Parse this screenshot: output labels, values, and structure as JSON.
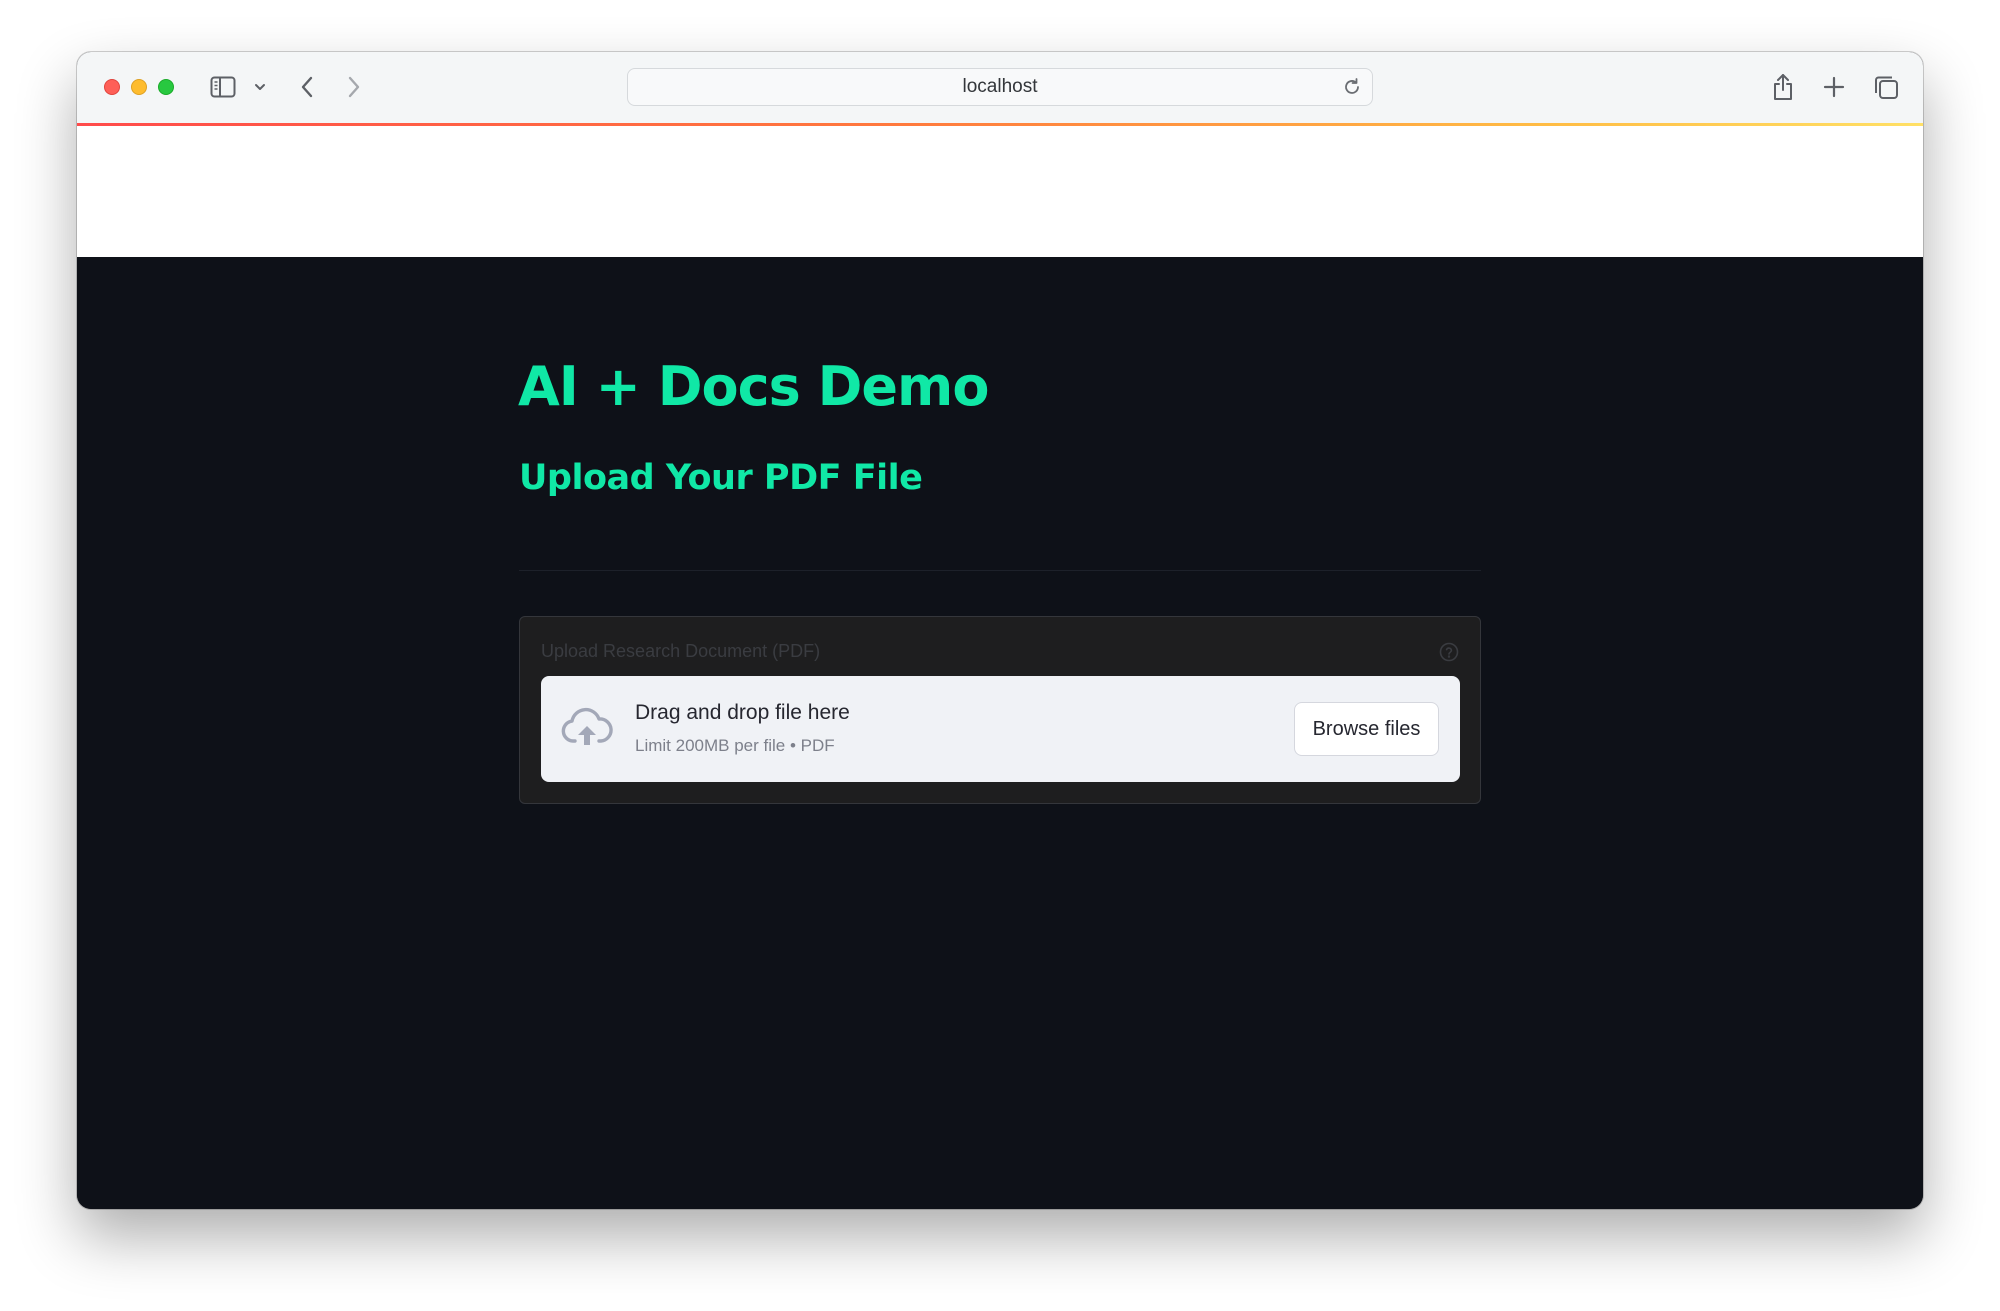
{
  "browser": {
    "url": "localhost",
    "icons": {
      "sidebar": "sidebar-icon",
      "tab_menu": "chevron-down-icon",
      "back": "chevron-left-icon",
      "forward": "chevron-right-icon",
      "reload": "reload-icon",
      "share": "share-icon",
      "new_tab": "plus-icon",
      "tab_overview": "tabs-icon"
    },
    "traffic_lights": {
      "close": "#fe5f57",
      "minimize": "#febc2e",
      "maximize": "#28c840"
    }
  },
  "app": {
    "title": "AI + Docs Demo",
    "subtitle": "Upload Your PDF File",
    "accent_color": "#10e8a6",
    "background_color": "#0e1118",
    "uploader": {
      "label": "Upload Research Document (PDF)",
      "help_icon": "help-circle-icon",
      "upload_icon": "cloud-upload-icon",
      "drop_text": "Drag and drop file here",
      "limit_text": "Limit 200MB per file • PDF",
      "button_label": "Browse files"
    }
  }
}
